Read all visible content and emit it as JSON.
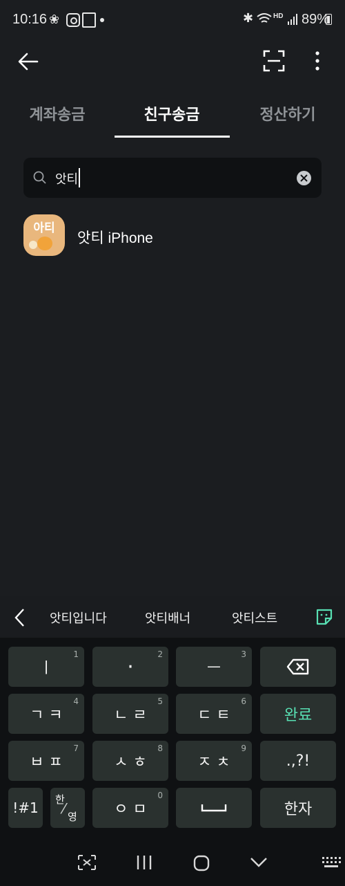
{
  "status": {
    "time": "10:16",
    "network": "HD",
    "battery": "89%"
  },
  "tabs": [
    {
      "label": "계좌송금",
      "active": false
    },
    {
      "label": "친구송금",
      "active": true
    },
    {
      "label": "정산하기",
      "active": false
    }
  ],
  "search": {
    "value": "앗티"
  },
  "results": [
    {
      "avatar_text": "아티",
      "name": "앗티 iPhone"
    }
  ],
  "suggestions": [
    "앗티입니다",
    "앗티배너",
    "앗티스트"
  ],
  "keyboard": {
    "rows": [
      [
        {
          "label": "ㅣ",
          "num": "1"
        },
        {
          "label": "·",
          "num": "2"
        },
        {
          "label": "ㅡ",
          "num": "3"
        },
        {
          "label": "backspace",
          "num": ""
        }
      ],
      [
        {
          "label": "ㄱ ㅋ",
          "num": "4"
        },
        {
          "label": "ㄴ ㄹ",
          "num": "5"
        },
        {
          "label": "ㄷ ㅌ",
          "num": "6"
        },
        {
          "label": "완료",
          "num": ""
        }
      ],
      [
        {
          "label": "ㅂ ㅍ",
          "num": "7"
        },
        {
          "label": "ㅅ ㅎ",
          "num": "8"
        },
        {
          "label": "ㅈ ㅊ",
          "num": "9"
        },
        {
          "label": ".,?!",
          "num": ""
        }
      ],
      [
        {
          "label": "!#1",
          "num": ""
        },
        {
          "label_top": "한",
          "label_bottom": "영",
          "num": ""
        },
        {
          "label": "ㅇ ㅁ",
          "num": "0"
        },
        {
          "label": "space",
          "num": ""
        },
        {
          "label": "한자",
          "num": ""
        }
      ]
    ]
  },
  "colors": {
    "accent_green": "#58e0b3",
    "bg": "#1b1d20",
    "key_bg": "#2a312f"
  }
}
